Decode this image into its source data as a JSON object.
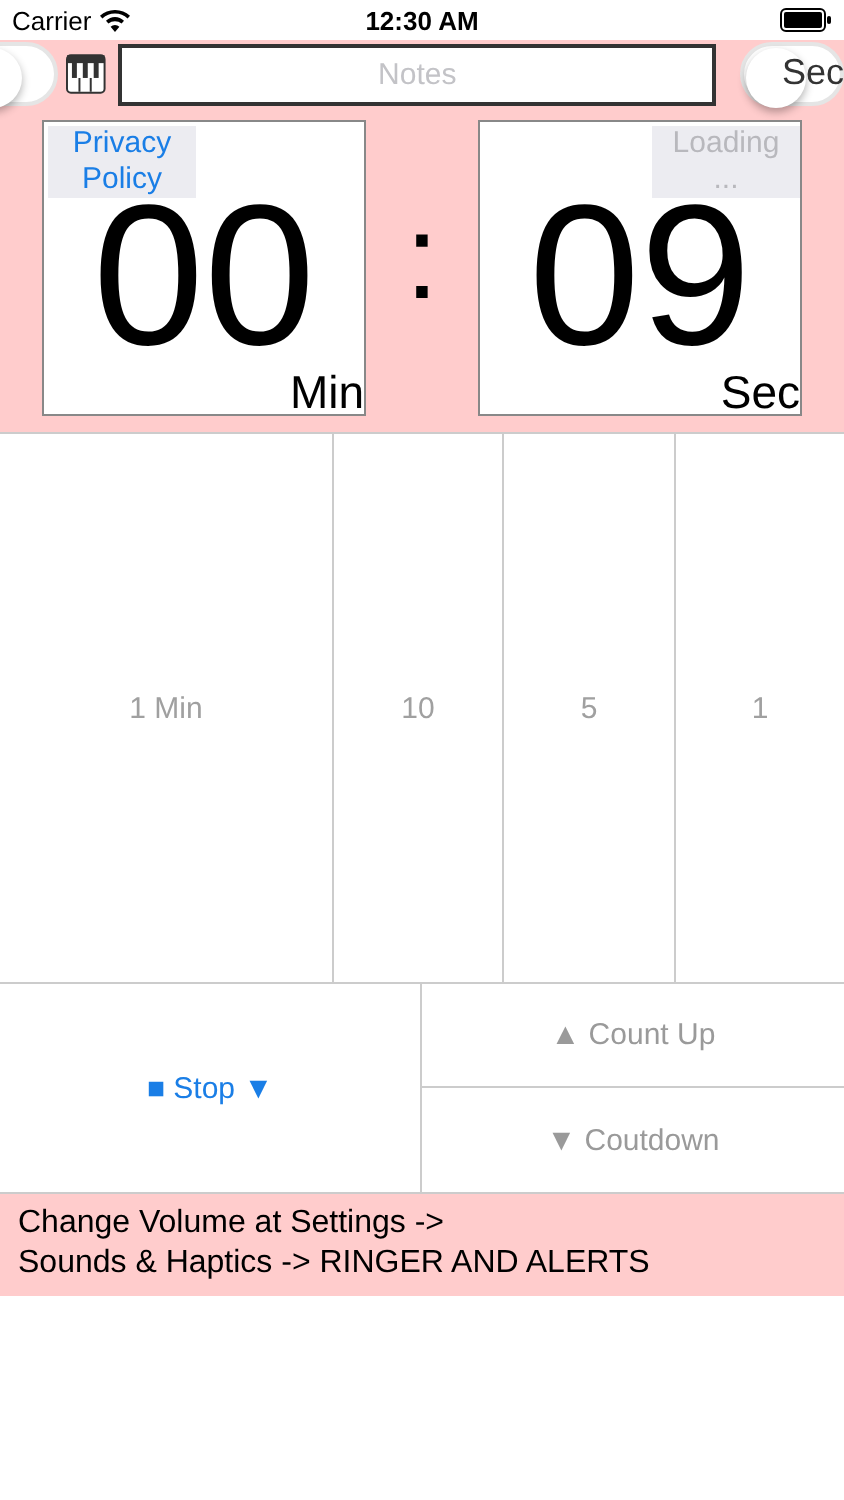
{
  "status_bar": {
    "carrier": "Carrier",
    "time": "12:30 AM"
  },
  "toolbar": {
    "left_switch": {
      "on": false
    },
    "notes": {
      "placeholder": "Notes"
    },
    "right_switch": {
      "on": false,
      "label": "Sec"
    }
  },
  "timer": {
    "minutes": {
      "value": "00",
      "unit": "Min",
      "link": {
        "label": "Privacy Policy",
        "disabled": false
      }
    },
    "separator": ":",
    "seconds": {
      "value": "09",
      "unit": "Sec",
      "link": {
        "label": "Loading ...",
        "disabled": true
      }
    }
  },
  "presets": [
    {
      "label": "1 Min"
    },
    {
      "label": "10"
    },
    {
      "label": "5"
    },
    {
      "label": "1"
    }
  ],
  "controls": {
    "stop": {
      "label": "■ Stop ▼",
      "disabled": false
    },
    "count_up": {
      "label": "▲ Count Up",
      "disabled": true
    },
    "countdown": {
      "label": "▼ Coutdown",
      "disabled": true
    }
  },
  "message": {
    "lines": [
      "Change Volume at Settings ->",
      "Sounds & Haptics -> RINGER AND ALERTS"
    ]
  }
}
